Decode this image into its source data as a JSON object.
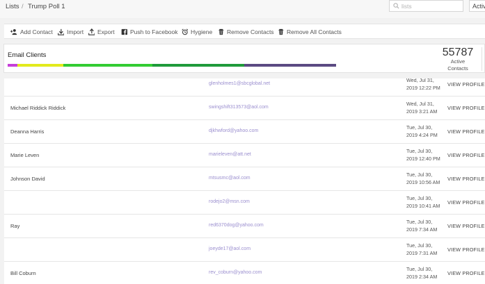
{
  "breadcrumb": {
    "root": "Lists",
    "separator": "/",
    "current": "Trump Poll 1"
  },
  "search": {
    "placeholder": "lists",
    "icon": "search-icon"
  },
  "status_select": {
    "value": "Activ"
  },
  "toolbar": [
    {
      "key": "add-contact",
      "label": "Add Contact",
      "icon": "add-person-icon"
    },
    {
      "key": "import",
      "label": "Import",
      "icon": "download-icon"
    },
    {
      "key": "export",
      "label": "Export",
      "icon": "upload-icon"
    },
    {
      "key": "push-to-facebook",
      "label": "Push to Facebook",
      "icon": "facebook-icon"
    },
    {
      "key": "hygiene",
      "label": "Hygiene",
      "icon": "alarm-clock-icon"
    },
    {
      "key": "remove-contacts",
      "label": "Remove Contacts",
      "icon": "trash-icon"
    },
    {
      "key": "remove-all-contacts",
      "label": "Remove All Contacts",
      "icon": "trash-icon"
    }
  ],
  "email_clients": {
    "title": "Email Clients",
    "active_count": "55787",
    "active_label_line1": "Active",
    "active_label_line2": "Contacts",
    "segments": [
      {
        "share": 0.03,
        "color": "#c63fd8"
      },
      {
        "share": 0.14,
        "color": "#e2ea1d"
      },
      {
        "share": 0.27,
        "color": "#33cc33"
      },
      {
        "share": 0.28,
        "color": "#1f9a3a"
      },
      {
        "share": 0.28,
        "color": "#5b4a82"
      }
    ]
  },
  "contacts": {
    "rows": [
      {
        "name": "",
        "email": "glenholmes1@sbcglobal.net",
        "date_line1": "Wed, Jul 31,",
        "date_line2": "2019 12:22 PM",
        "action": "VIEW PROFILE"
      },
      {
        "name": "Michael Riddick Riddick",
        "email": "swingshift313573@aol.com",
        "date_line1": "Wed, Jul 31,",
        "date_line2": "2019 3:21 AM",
        "action": "VIEW PROFILE"
      },
      {
        "name": "Deanna Harris",
        "email": "djkhwford@yahoo.com",
        "date_line1": "Tue, Jul 30,",
        "date_line2": "2019 4:24 PM",
        "action": "VIEW PROFILE"
      },
      {
        "name": "Marie Leven",
        "email": "marieleven@att.net",
        "date_line1": "Tue, Jul 30,",
        "date_line2": "2019 12:40 PM",
        "action": "VIEW PROFILE"
      },
      {
        "name": "Johnson David",
        "email": "mtsusmc@aol.com",
        "date_line1": "Tue, Jul 30,",
        "date_line2": "2019 10:56 AM",
        "action": "VIEW PROFILE"
      },
      {
        "name": "",
        "email": "rodejo2@msn.com",
        "date_line1": "Tue, Jul 30,",
        "date_line2": "2019 10:41 AM",
        "action": "VIEW PROFILE"
      },
      {
        "name": "Ray",
        "email": "red6370dog@yahoo.com",
        "date_line1": "Tue, Jul 30,",
        "date_line2": "2019 7:34 AM",
        "action": "VIEW PROFILE"
      },
      {
        "name": "",
        "email": "joeyde17@aol.com",
        "date_line1": "Tue, Jul 30,",
        "date_line2": "2019 7:31 AM",
        "action": "VIEW PROFILE"
      },
      {
        "name": "Bill Coburn",
        "email": "rev_coburn@yahoo.com",
        "date_line1": "Tue, Jul 30,",
        "date_line2": "2019 2:34 AM",
        "action": "VIEW PROFILE"
      }
    ]
  }
}
